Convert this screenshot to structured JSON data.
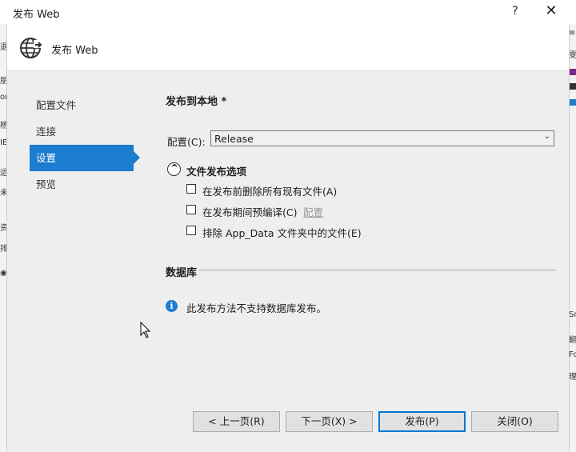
{
  "window": {
    "title": "发布 Web",
    "help_glyph": "?",
    "close_glyph": "✕"
  },
  "header": {
    "title": "发布 Web",
    "icon": "globe-publish-icon"
  },
  "background_left": [
    "退",
    "朋",
    "or",
    "杨",
    "IE",
    "运",
    "未",
    "资",
    "排",
    "◉"
  ],
  "background_right": [
    "≡",
    "雯",
    "Sr",
    "翻",
    "Fo",
    "理"
  ],
  "nav": {
    "items": [
      {
        "label": "配置文件"
      },
      {
        "label": "连接"
      },
      {
        "label": "设置"
      },
      {
        "label": "预览"
      }
    ],
    "active_index": 2
  },
  "main": {
    "section_title": "发布到本地 *",
    "config_label": "配置(C):",
    "config_value": "Release",
    "config_arrow": "⌄",
    "file_options": {
      "title": "文件发布选项",
      "toggle_glyph": "^",
      "options": [
        {
          "label": "在发布前删除所有现有文件(A)",
          "checked": false
        },
        {
          "label": "在发布期间预编译(C)",
          "checked": false,
          "link": "配置"
        },
        {
          "label": "排除 App_Data 文件夹中的文件(E)",
          "checked": false
        }
      ]
    },
    "database": {
      "title": "数据库",
      "info_glyph": "i",
      "info_text": "此发布方法不支持数据库发布。"
    }
  },
  "buttons": {
    "prev": "< 上一页(R)",
    "next": "下一页(X) >",
    "publish": "发布(P)",
    "close": "关闭(O)"
  },
  "colors": {
    "accent": "#1c7ccf",
    "dialog_bg": "#eeeeee",
    "button_bg": "#e1e1e1"
  }
}
